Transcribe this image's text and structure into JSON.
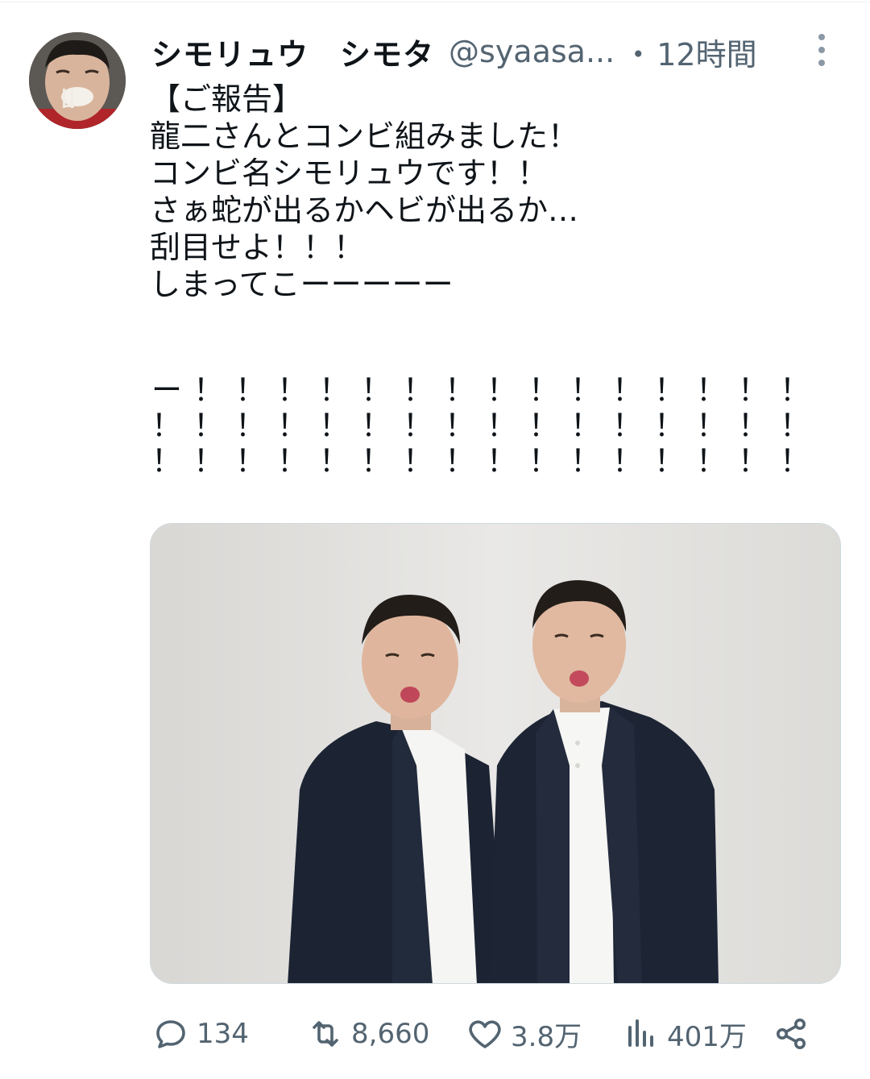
{
  "tweet": {
    "display_name": "シモリュウ　シモタ",
    "handle": "@syaasa...",
    "separator": "・",
    "time": "12時間",
    "text_lines": [
      "【ご報告】",
      "龍二さんとコンビ組みました！",
      "コンビ名シモリュウです！！",
      "さぁ蛇が出るかヘビが出るか…",
      "刮目せよ！！！",
      "しまってこーーーーー"
    ],
    "exclaim_lines": [
      "ー！！！！！！！！！！！！！！！！！！！",
      "！！！！！！！！！！！！！！！！！！！！",
      "！！！！！！！！！！！！！！！！！！！！"
    ]
  },
  "actions": {
    "replies": "134",
    "retweets": "8,660",
    "likes": "3.8万",
    "views": "401万"
  },
  "icons": {
    "more": "more-vertical-icon",
    "reply": "reply-icon",
    "retweet": "retweet-icon",
    "like": "heart-icon",
    "views": "analytics-icon",
    "share": "share-icon"
  },
  "colors": {
    "text": "#0f1419",
    "muted": "#536471",
    "border": "#cfd9de"
  }
}
